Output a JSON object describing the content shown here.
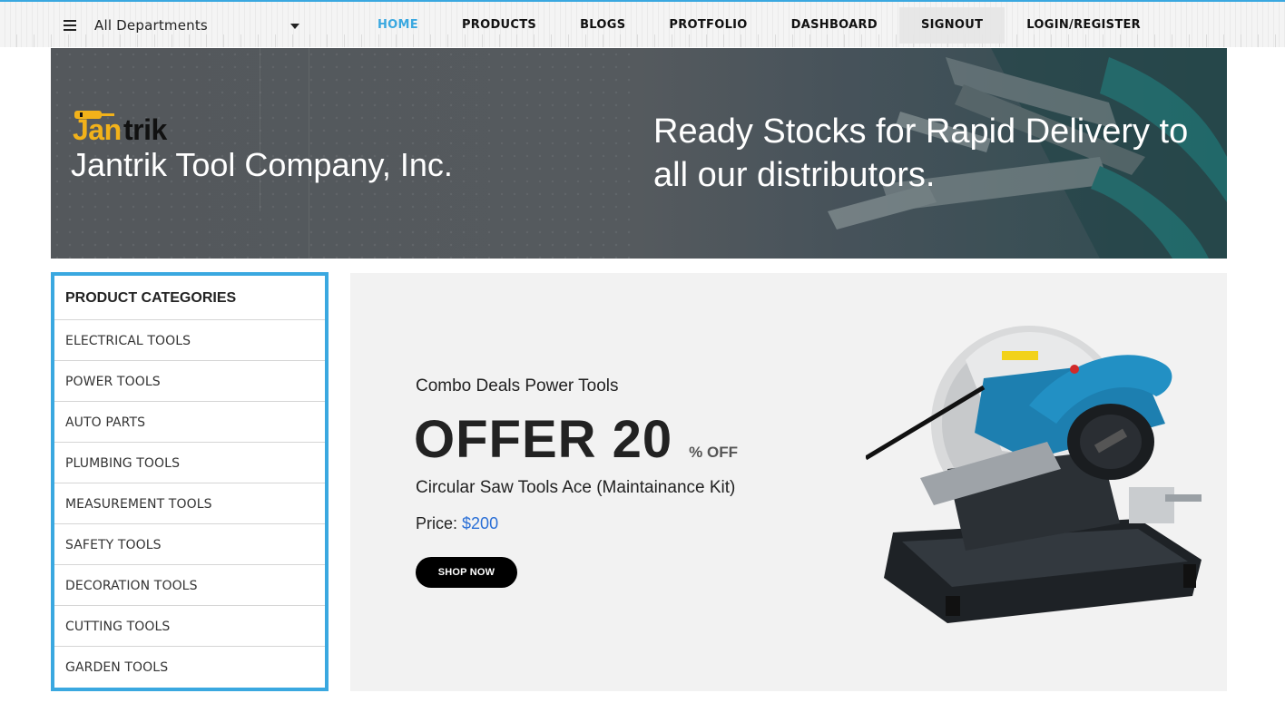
{
  "topbar": {
    "departments_label": "All Departments",
    "nav": [
      {
        "label": "HOME",
        "active": true
      },
      {
        "label": "PRODUCTS",
        "active": false
      },
      {
        "label": "BLOGS",
        "active": false
      },
      {
        "label": "PROTFOLIO",
        "active": false
      },
      {
        "label": "DASHBOARD",
        "active": false
      },
      {
        "label": "SIGNOUT",
        "active": false
      },
      {
        "label": "LOGIN/REGISTER",
        "active": false
      }
    ]
  },
  "hero": {
    "logo_part1": "Jan",
    "logo_part2": "trik",
    "company_name": "Jantrik Tool Company, Inc.",
    "tagline": "Ready Stocks for Rapid Delivery to all our distributors."
  },
  "categories": {
    "title": "PRODUCT CATEGORIES",
    "items": [
      "ELECTRICAL TOOLS",
      "POWER TOOLS",
      "AUTO PARTS",
      "PLUMBING TOOLS",
      "MEASUREMENT TOOLS",
      "SAFETY TOOLS",
      "DECORATION TOOLS",
      "CUTTING TOOLS",
      "GARDEN TOOLS"
    ]
  },
  "offer": {
    "subtitle": "Combo Deals Power Tools",
    "headline": "OFFER 20",
    "unit": "% OFF",
    "product_name": "Circular Saw Tools Ace (Maintainance Kit)",
    "price_label": "Price:",
    "price_value": "$200",
    "button_label": "SHOP NOW"
  },
  "colors": {
    "accent": "#3aa8e0",
    "price": "#2a6fd6",
    "logo_yellow": "#f2b21a"
  }
}
